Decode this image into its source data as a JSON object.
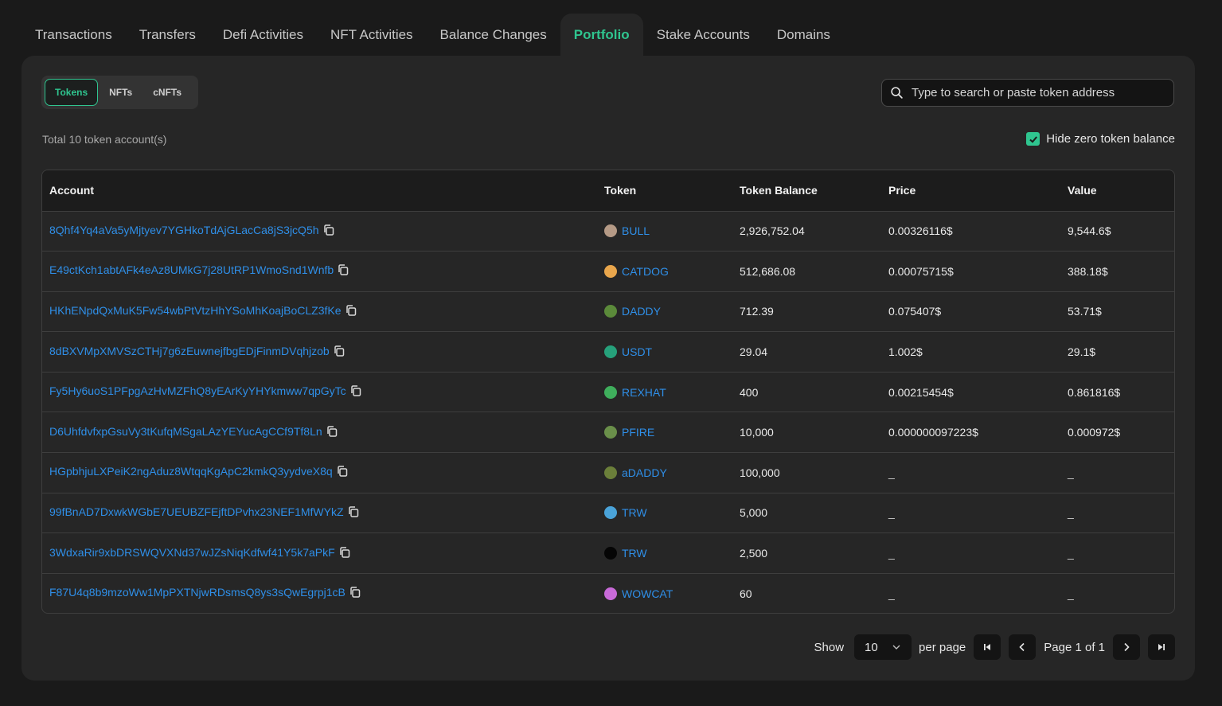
{
  "tabs": [
    {
      "label": "Transactions"
    },
    {
      "label": "Transfers"
    },
    {
      "label": "Defi Activities"
    },
    {
      "label": "NFT Activities"
    },
    {
      "label": "Balance Changes"
    },
    {
      "label": "Portfolio",
      "active": true
    },
    {
      "label": "Stake Accounts"
    },
    {
      "label": "Domains"
    }
  ],
  "segments": [
    {
      "label": "Tokens",
      "active": true
    },
    {
      "label": "NFTs"
    },
    {
      "label": "cNFTs"
    }
  ],
  "search": {
    "placeholder": "Type to search or paste token address",
    "icon": "search-icon"
  },
  "summary": {
    "total_text": "Total 10 token account(s)"
  },
  "filter": {
    "hide_zero_label": "Hide zero token balance",
    "hide_zero_checked": true
  },
  "table": {
    "columns": [
      "Account",
      "Token",
      "Token Balance",
      "Price",
      "Value"
    ],
    "rows": [
      {
        "account": "8Qhf4Yq4aVa5yMjtyev7YGHkoTdAjGLacCa8jS3jcQ5h",
        "token": "BULL",
        "icon_color": "#b59a86",
        "balance": "2,926,752.04",
        "price": "0.00326116$",
        "value": "9,544.6$"
      },
      {
        "account": "E49ctKch1abtAFk4eAz8UMkG7j28UtRP1WmoSnd1Wnfb",
        "token": "CATDOG",
        "icon_color": "#e9a64c",
        "balance": "512,686.08",
        "price": "0.00075715$",
        "value": "388.18$"
      },
      {
        "account": "HKhENpdQxMuK5Fw54wbPtVtzHhYSoMhKoajBoCLZ3fKe",
        "token": "DADDY",
        "icon_color": "#5b8a3a",
        "balance": "712.39",
        "price": "0.075407$",
        "value": "53.71$"
      },
      {
        "account": "8dBXVMpXMVSzCTHj7g6zEuwnejfbgEDjFinmDVqhjzob",
        "token": "USDT",
        "icon_color": "#26a17b",
        "balance": "29.04",
        "price": "1.002$",
        "value": "29.1$"
      },
      {
        "account": "Fy5Hy6uoS1PFpgAzHvMZFhQ8yEArKyYHYkmww7qpGyTc",
        "token": "REXHAT",
        "icon_color": "#3fae5c",
        "balance": "400",
        "price": "0.00215454$",
        "value": "0.861816$"
      },
      {
        "account": "D6UhfdvfxpGsuVy3tKufqMSgaLAzYEYucAgCCf9Tf8Ln",
        "token": "PFIRE",
        "icon_color": "#6a8f4a",
        "balance": "10,000",
        "price": "0.000000097223$",
        "value": "0.000972$"
      },
      {
        "account": "HGpbhjuLXPeiK2ngAduz8WtqqKgApC2kmkQ3yydveX8q",
        "token": "aDADDY",
        "icon_color": "#6b7f3a",
        "balance": "100,000",
        "price": "_",
        "value": "_"
      },
      {
        "account": "99fBnAD7DxwkWGbE7UEUBZFEjftDPvhx23NEF1MfWYkZ",
        "token": "TRW",
        "icon_color": "#4aa3d8",
        "balance": "5,000",
        "price": "_",
        "value": "_"
      },
      {
        "account": "3WdxaRir9xbDRSWQVXNd37wJZsNiqKdfwf41Y5k7aPkF",
        "token": "TRW",
        "icon_color": "#050505",
        "balance": "2,500",
        "price": "_",
        "value": "_"
      },
      {
        "account": "F87U4q8b9mzoWw1MpPXTNjwRDsmsQ8ys3sQwEgrpj1cB",
        "token": "WOWCAT",
        "icon_color": "#c86ad8",
        "balance": "60",
        "price": "_",
        "value": "_"
      }
    ]
  },
  "pagination": {
    "show_label": "Show",
    "per_page_value": "10",
    "per_page_label": "per page",
    "page_text": "Page 1 of 1"
  },
  "colors": {
    "accent": "#2fc58f",
    "link": "#2f8fe8"
  }
}
